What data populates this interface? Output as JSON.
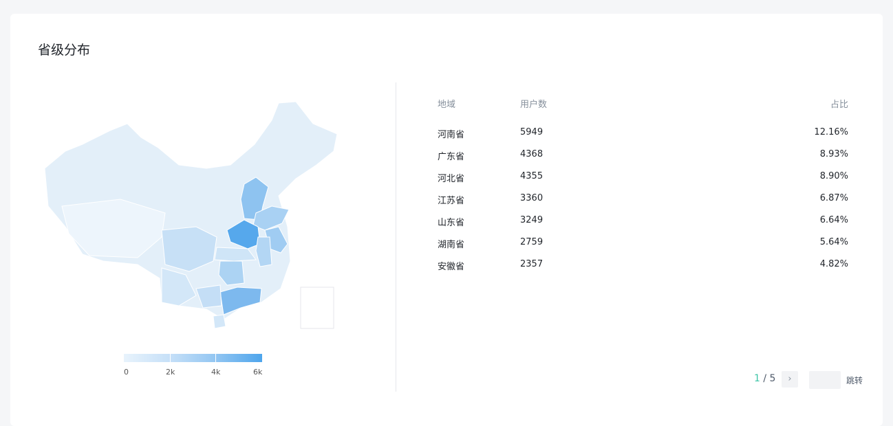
{
  "title": "省级分布",
  "legend": {
    "ticks": [
      "0",
      "2k",
      "4k",
      "6k"
    ],
    "min": 0,
    "max": 6000,
    "colors": [
      "#e8f3fc",
      "#4ea5ec"
    ]
  },
  "table": {
    "headers": [
      "地域",
      "用户数",
      "占比"
    ],
    "rows": [
      {
        "region": "河南省",
        "users": "5949",
        "ratio": "12.16%"
      },
      {
        "region": "广东省",
        "users": "4368",
        "ratio": "8.93%"
      },
      {
        "region": "河北省",
        "users": "4355",
        "ratio": "8.90%"
      },
      {
        "region": "江苏省",
        "users": "3360",
        "ratio": "6.87%"
      },
      {
        "region": "山东省",
        "users": "3249",
        "ratio": "6.64%"
      },
      {
        "region": "湖南省",
        "users": "2759",
        "ratio": "5.64%"
      },
      {
        "region": "安徽省",
        "users": "2357",
        "ratio": "4.82%"
      }
    ]
  },
  "pagination": {
    "current": "1",
    "separator": "/",
    "total": "5",
    "jump_label": "跳转",
    "jump_value": ""
  }
}
